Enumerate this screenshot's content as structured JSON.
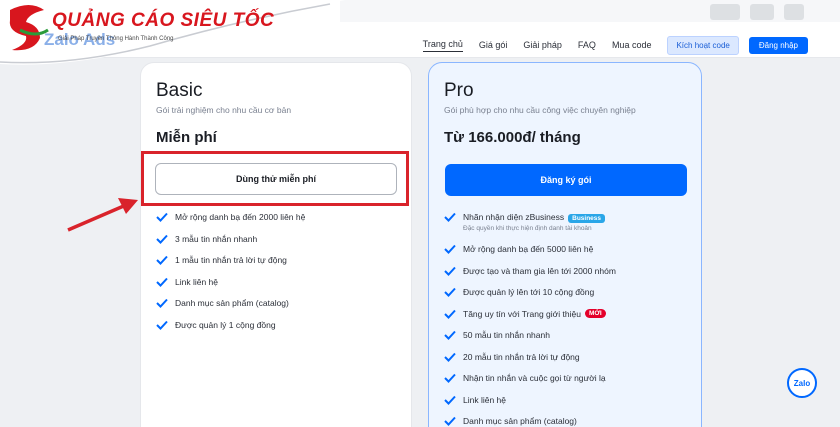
{
  "logo": {
    "title": "QUẢNG CÁO SIÊU TỐC",
    "subtitle": "Giải Pháp Truyền Thông Hành Thành Công",
    "ghost_text": "Zalo Ads"
  },
  "nav": {
    "items": [
      "Trang chủ",
      "Giá gói",
      "Giải pháp",
      "FAQ",
      "Mua code"
    ],
    "activate_label": "Kích hoạt code",
    "login_label": "Đăng nhập"
  },
  "basic": {
    "title": "Basic",
    "description": "Gói trải nghiệm cho nhu cầu cơ bản",
    "price": "Miễn phí",
    "cta": "Dùng thử miễn phí",
    "features": [
      "Mở rộng danh bạ đến 2000 liên hệ",
      "3 mẫu tin nhắn nhanh",
      "1 mẫu tin nhắn trả lời tự động",
      "Link liên hệ",
      "Danh mục sản phẩm (catalog)",
      "Được quản lý 1 cộng đồng"
    ]
  },
  "pro": {
    "title": "Pro",
    "description": "Gói phù hợp cho nhu cầu công việc chuyên nghiệp",
    "price": "Từ 166.000đ/ tháng",
    "cta": "Đăng ký gói",
    "feature_first": "Nhãn nhận diện zBusiness",
    "feature_first_badge": "Business",
    "feature_first_note": "Đặc quyền khi thực hiện định danh tài khoản",
    "features_mid": [
      "Mở rộng danh bạ đến 5000 liên hệ",
      "Được tạo và tham gia lên tới 2000 nhóm",
      "Được quản lý lên tới 10 cộng đồng"
    ],
    "feature_new": "Tăng uy tín với Trang giới thiệu",
    "feature_new_badge": "MỚI",
    "features_end": [
      "50 mẫu tin nhắn nhanh",
      "20 mẫu tin nhắn trả lời tự động",
      "Nhận tin nhắn và cuộc gọi từ người lạ",
      "Link liên hệ",
      "Danh mục sản phẩm (catalog)"
    ]
  },
  "fab": {
    "label": "Zalo"
  },
  "colors": {
    "accent": "#0068ff",
    "annotation": "#d9232b"
  }
}
